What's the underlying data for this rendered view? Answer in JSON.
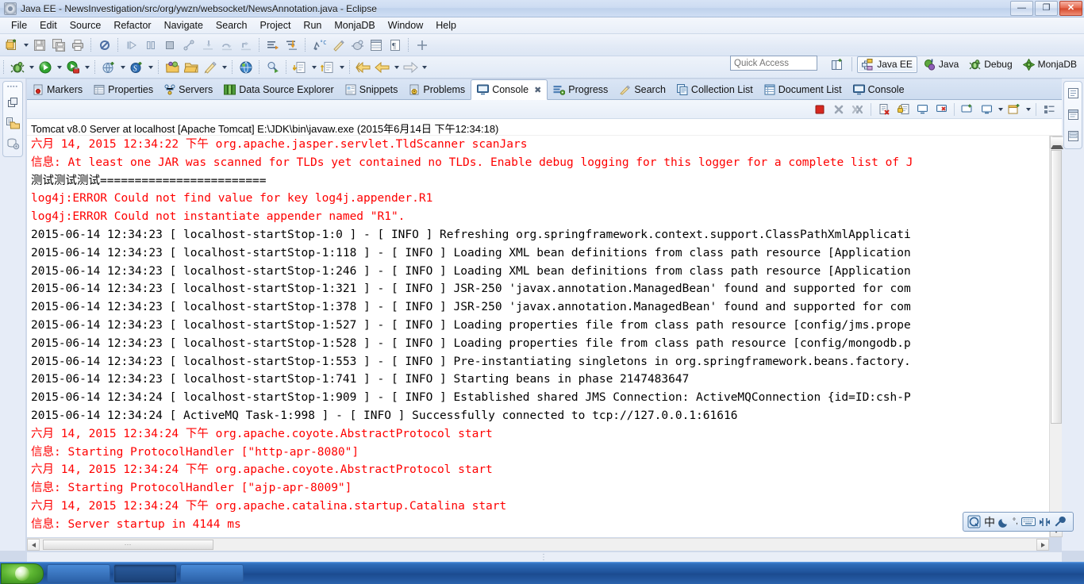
{
  "window": {
    "title": "Java EE - NewsInvestigation/src/org/ywzn/websocket/NewsAnnotation.java - Eclipse",
    "minimize_label": "—",
    "maximize_label": "❐",
    "close_label": "✕"
  },
  "menu": {
    "items": [
      "File",
      "Edit",
      "Source",
      "Refactor",
      "Navigate",
      "Search",
      "Project",
      "Run",
      "MonjaDB",
      "Window",
      "Help"
    ]
  },
  "toolbar": {
    "icons": [
      "new-file-icon",
      "new-dropdown-arrow",
      "save-icon",
      "save-all-icon",
      "print-icon",
      "skip-breakpoints-icon",
      "resume-icon",
      "suspend-icon",
      "terminate-icon",
      "disconnect-icon",
      "step-into-icon",
      "step-over-icon",
      "step-return-icon",
      "open-type-icon",
      "open-task-icon",
      "toggle-breakpoint-icon",
      "measure-icon",
      "debug-build-icon",
      "table-icon",
      "paragraph-icon"
    ]
  },
  "toolbar2": {
    "icons": [
      "debug-icon",
      "run-icon",
      "run-coverage-icon",
      "new-web-project-icon",
      "new-server-icon",
      "open-resource-icon",
      "open-folder-icon",
      "edit-pen-icon",
      "web-browser-icon",
      "search-refactor-icon",
      "next-annotation-icon",
      "previous-annotation-icon",
      "back-icon",
      "back-history-icon",
      "forward-icon"
    ]
  },
  "quick_access": {
    "placeholder": "Quick Access",
    "value": ""
  },
  "perspectives": {
    "open_perspective_label": "",
    "items": [
      {
        "label": "Java EE",
        "icon": "java-ee-perspective-icon",
        "active": true
      },
      {
        "label": "Java",
        "icon": "java-perspective-icon",
        "active": false
      },
      {
        "label": "Debug",
        "icon": "debug-perspective-icon",
        "active": false
      },
      {
        "label": "MonjaDB",
        "icon": "monjadb-perspective-icon",
        "active": false
      }
    ]
  },
  "left_rail": {
    "icons": [
      "restore-view-icon",
      "project-explorer-icon",
      "data-source-explorer-icon"
    ]
  },
  "right_rail": {
    "icons": [
      "outline-view-icon",
      "task-list-icon",
      "palette-icon"
    ]
  },
  "view_tabs": [
    {
      "label": "Markers",
      "icon": "markers-icon",
      "active": false,
      "closable": false
    },
    {
      "label": "Properties",
      "icon": "properties-icon",
      "active": false,
      "closable": false
    },
    {
      "label": "Servers",
      "icon": "servers-icon",
      "active": false,
      "closable": false
    },
    {
      "label": "Data Source Explorer",
      "icon": "data-source-explorer-icon",
      "active": false,
      "closable": false
    },
    {
      "label": "Snippets",
      "icon": "snippets-icon",
      "active": false,
      "closable": false
    },
    {
      "label": "Problems",
      "icon": "problems-icon",
      "active": false,
      "closable": false
    },
    {
      "label": "Console",
      "icon": "console-icon",
      "active": true,
      "closable": true
    },
    {
      "label": "Progress",
      "icon": "progress-icon",
      "active": false,
      "closable": false
    },
    {
      "label": "Search",
      "icon": "search-icon",
      "active": false,
      "closable": false
    },
    {
      "label": "Collection List",
      "icon": "collection-list-icon",
      "active": false,
      "closable": false
    },
    {
      "label": "Document List",
      "icon": "document-list-icon",
      "active": false,
      "closable": false
    },
    {
      "label": "Console",
      "icon": "console-icon",
      "active": false,
      "closable": false
    }
  ],
  "console_toolbar": {
    "icons": [
      "terminate-icon",
      "remove-launch-icon",
      "remove-all-terminated-icon",
      "clear-console-icon",
      "scroll-lock-icon",
      "pin-console-icon",
      "display-selected-console-icon",
      "open-console-icon",
      "open-console-dropdown-icon",
      "new-console-view-icon",
      "new-console-dropdown-icon",
      "view-menu-icon"
    ]
  },
  "console": {
    "header": "Tomcat v8.0 Server at localhost [Apache Tomcat] E:\\JDK\\bin\\javaw.exe (2015年6月14日 下午12:34:18)",
    "lines": [
      {
        "color": "red",
        "text": "六月 14, 2015 12:34:22 下午 org.apache.jasper.servlet.TldScanner scanJars"
      },
      {
        "color": "red",
        "text": "信息: At least one JAR was scanned for TLDs yet contained no TLDs. Enable debug logging for this logger for a complete list of J"
      },
      {
        "color": "black",
        "text": "测试测试测试========================"
      },
      {
        "color": "red",
        "text": "log4j:ERROR Could not find value for key log4j.appender.R1"
      },
      {
        "color": "red",
        "text": "log4j:ERROR Could not instantiate appender named \"R1\"."
      },
      {
        "color": "black",
        "text": "2015-06-14 12:34:23 [ localhost-startStop-1:0 ] - [ INFO ] Refreshing org.springframework.context.support.ClassPathXmlApplicati"
      },
      {
        "color": "black",
        "text": "2015-06-14 12:34:23 [ localhost-startStop-1:118 ] - [ INFO ] Loading XML bean definitions from class path resource [Application"
      },
      {
        "color": "black",
        "text": "2015-06-14 12:34:23 [ localhost-startStop-1:246 ] - [ INFO ] Loading XML bean definitions from class path resource [Application"
      },
      {
        "color": "black",
        "text": "2015-06-14 12:34:23 [ localhost-startStop-1:321 ] - [ INFO ] JSR-250 'javax.annotation.ManagedBean' found and supported for com"
      },
      {
        "color": "black",
        "text": "2015-06-14 12:34:23 [ localhost-startStop-1:378 ] - [ INFO ] JSR-250 'javax.annotation.ManagedBean' found and supported for com"
      },
      {
        "color": "black",
        "text": "2015-06-14 12:34:23 [ localhost-startStop-1:527 ] - [ INFO ] Loading properties file from class path resource [config/jms.prope"
      },
      {
        "color": "black",
        "text": "2015-06-14 12:34:23 [ localhost-startStop-1:528 ] - [ INFO ] Loading properties file from class path resource [config/mongodb.p"
      },
      {
        "color": "black",
        "text": "2015-06-14 12:34:23 [ localhost-startStop-1:553 ] - [ INFO ] Pre-instantiating singletons in org.springframework.beans.factory."
      },
      {
        "color": "black",
        "text": "2015-06-14 12:34:23 [ localhost-startStop-1:741 ] - [ INFO ] Starting beans in phase 2147483647"
      },
      {
        "color": "black",
        "text": "2015-06-14 12:34:24 [ localhost-startStop-1:909 ] - [ INFO ] Established shared JMS Connection: ActiveMQConnection {id=ID:csh-P"
      },
      {
        "color": "black",
        "text": "2015-06-14 12:34:24 [ ActiveMQ Task-1:998 ] - [ INFO ] Successfully connected to tcp://127.0.0.1:61616"
      },
      {
        "color": "red",
        "text": "六月 14, 2015 12:34:24 下午 org.apache.coyote.AbstractProtocol start"
      },
      {
        "color": "red",
        "text": "信息: Starting ProtocolHandler [\"http-apr-8080\"]"
      },
      {
        "color": "red",
        "text": "六月 14, 2015 12:34:24 下午 org.apache.coyote.AbstractProtocol start"
      },
      {
        "color": "red",
        "text": "信息: Starting ProtocolHandler [\"ajp-apr-8009\"]"
      },
      {
        "color": "red",
        "text": "六月 14, 2015 12:34:24 下午 org.apache.catalina.startup.Catalina start"
      },
      {
        "color": "red",
        "text": "信息: Server startup in 4144 ms"
      }
    ]
  },
  "scrollbars": {
    "h_thumb_label": "⋯",
    "v_up": "▲",
    "v_down": "▼",
    "h_left": "◀",
    "h_right": "▶"
  },
  "sash": {
    "handle": "⋮"
  },
  "ime": {
    "items": [
      {
        "name": "ime-logo-icon",
        "label": ""
      },
      {
        "name": "chinese-mode-icon",
        "label": "中"
      },
      {
        "name": "moon-icon",
        "label": ""
      },
      {
        "name": "punctuation-icon",
        "label": "°,"
      },
      {
        "name": "soft-keyboard-icon",
        "label": ""
      },
      {
        "name": "full-width-icon",
        "label": ""
      },
      {
        "name": "settings-wrench-icon",
        "label": ""
      }
    ]
  },
  "taskbar": {
    "start_label": "",
    "items": [
      "",
      "",
      ""
    ]
  },
  "colors": {
    "console_error": "#fe0000",
    "console_text": "#000000",
    "title_bar": "#cddcf2",
    "taskbar": "#1d4f96"
  }
}
